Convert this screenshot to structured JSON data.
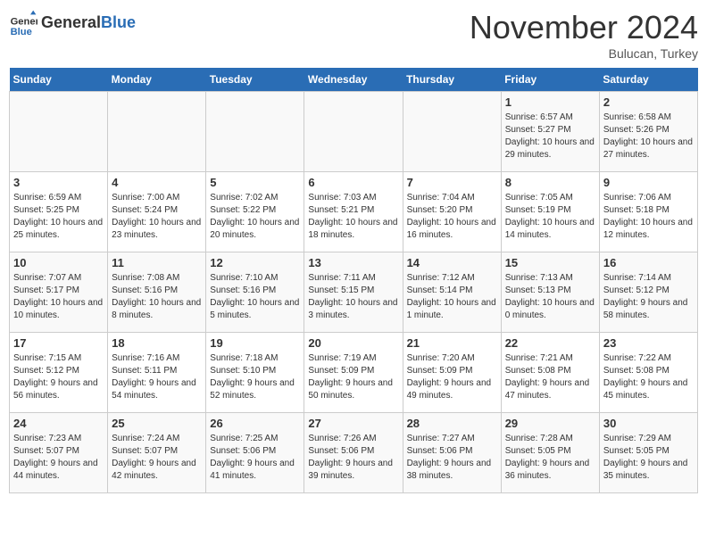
{
  "header": {
    "logo_line1": "General",
    "logo_line2": "Blue",
    "month_title": "November 2024",
    "subtitle": "Bulucan, Turkey"
  },
  "weekdays": [
    "Sunday",
    "Monday",
    "Tuesday",
    "Wednesday",
    "Thursday",
    "Friday",
    "Saturday"
  ],
  "weeks": [
    [
      {
        "day": "",
        "info": ""
      },
      {
        "day": "",
        "info": ""
      },
      {
        "day": "",
        "info": ""
      },
      {
        "day": "",
        "info": ""
      },
      {
        "day": "",
        "info": ""
      },
      {
        "day": "1",
        "info": "Sunrise: 6:57 AM\nSunset: 5:27 PM\nDaylight: 10 hours and 29 minutes."
      },
      {
        "day": "2",
        "info": "Sunrise: 6:58 AM\nSunset: 5:26 PM\nDaylight: 10 hours and 27 minutes."
      }
    ],
    [
      {
        "day": "3",
        "info": "Sunrise: 6:59 AM\nSunset: 5:25 PM\nDaylight: 10 hours and 25 minutes."
      },
      {
        "day": "4",
        "info": "Sunrise: 7:00 AM\nSunset: 5:24 PM\nDaylight: 10 hours and 23 minutes."
      },
      {
        "day": "5",
        "info": "Sunrise: 7:02 AM\nSunset: 5:22 PM\nDaylight: 10 hours and 20 minutes."
      },
      {
        "day": "6",
        "info": "Sunrise: 7:03 AM\nSunset: 5:21 PM\nDaylight: 10 hours and 18 minutes."
      },
      {
        "day": "7",
        "info": "Sunrise: 7:04 AM\nSunset: 5:20 PM\nDaylight: 10 hours and 16 minutes."
      },
      {
        "day": "8",
        "info": "Sunrise: 7:05 AM\nSunset: 5:19 PM\nDaylight: 10 hours and 14 minutes."
      },
      {
        "day": "9",
        "info": "Sunrise: 7:06 AM\nSunset: 5:18 PM\nDaylight: 10 hours and 12 minutes."
      }
    ],
    [
      {
        "day": "10",
        "info": "Sunrise: 7:07 AM\nSunset: 5:17 PM\nDaylight: 10 hours and 10 minutes."
      },
      {
        "day": "11",
        "info": "Sunrise: 7:08 AM\nSunset: 5:16 PM\nDaylight: 10 hours and 8 minutes."
      },
      {
        "day": "12",
        "info": "Sunrise: 7:10 AM\nSunset: 5:16 PM\nDaylight: 10 hours and 5 minutes."
      },
      {
        "day": "13",
        "info": "Sunrise: 7:11 AM\nSunset: 5:15 PM\nDaylight: 10 hours and 3 minutes."
      },
      {
        "day": "14",
        "info": "Sunrise: 7:12 AM\nSunset: 5:14 PM\nDaylight: 10 hours and 1 minute."
      },
      {
        "day": "15",
        "info": "Sunrise: 7:13 AM\nSunset: 5:13 PM\nDaylight: 10 hours and 0 minutes."
      },
      {
        "day": "16",
        "info": "Sunrise: 7:14 AM\nSunset: 5:12 PM\nDaylight: 9 hours and 58 minutes."
      }
    ],
    [
      {
        "day": "17",
        "info": "Sunrise: 7:15 AM\nSunset: 5:12 PM\nDaylight: 9 hours and 56 minutes."
      },
      {
        "day": "18",
        "info": "Sunrise: 7:16 AM\nSunset: 5:11 PM\nDaylight: 9 hours and 54 minutes."
      },
      {
        "day": "19",
        "info": "Sunrise: 7:18 AM\nSunset: 5:10 PM\nDaylight: 9 hours and 52 minutes."
      },
      {
        "day": "20",
        "info": "Sunrise: 7:19 AM\nSunset: 5:09 PM\nDaylight: 9 hours and 50 minutes."
      },
      {
        "day": "21",
        "info": "Sunrise: 7:20 AM\nSunset: 5:09 PM\nDaylight: 9 hours and 49 minutes."
      },
      {
        "day": "22",
        "info": "Sunrise: 7:21 AM\nSunset: 5:08 PM\nDaylight: 9 hours and 47 minutes."
      },
      {
        "day": "23",
        "info": "Sunrise: 7:22 AM\nSunset: 5:08 PM\nDaylight: 9 hours and 45 minutes."
      }
    ],
    [
      {
        "day": "24",
        "info": "Sunrise: 7:23 AM\nSunset: 5:07 PM\nDaylight: 9 hours and 44 minutes."
      },
      {
        "day": "25",
        "info": "Sunrise: 7:24 AM\nSunset: 5:07 PM\nDaylight: 9 hours and 42 minutes."
      },
      {
        "day": "26",
        "info": "Sunrise: 7:25 AM\nSunset: 5:06 PM\nDaylight: 9 hours and 41 minutes."
      },
      {
        "day": "27",
        "info": "Sunrise: 7:26 AM\nSunset: 5:06 PM\nDaylight: 9 hours and 39 minutes."
      },
      {
        "day": "28",
        "info": "Sunrise: 7:27 AM\nSunset: 5:06 PM\nDaylight: 9 hours and 38 minutes."
      },
      {
        "day": "29",
        "info": "Sunrise: 7:28 AM\nSunset: 5:05 PM\nDaylight: 9 hours and 36 minutes."
      },
      {
        "day": "30",
        "info": "Sunrise: 7:29 AM\nSunset: 5:05 PM\nDaylight: 9 hours and 35 minutes."
      }
    ]
  ]
}
